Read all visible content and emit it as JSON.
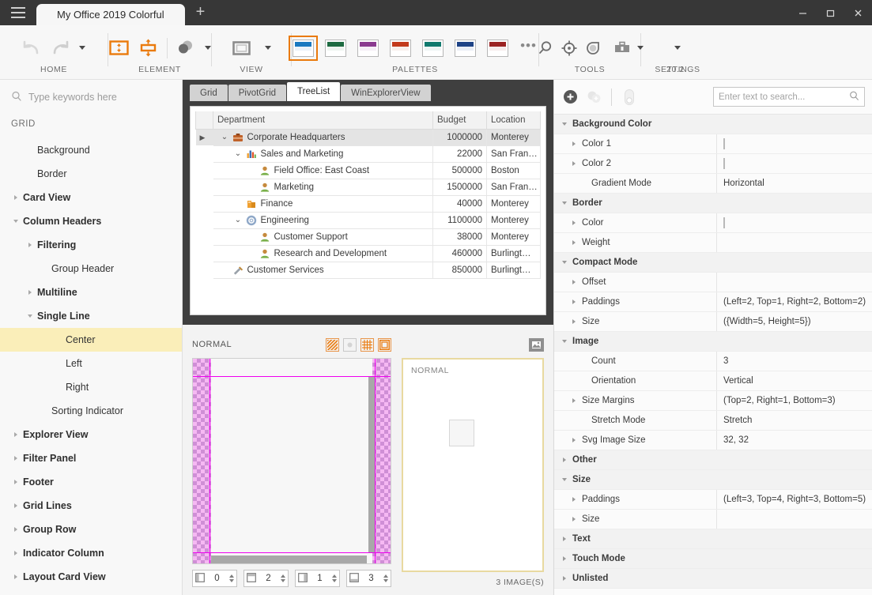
{
  "window": {
    "tab_title": "My Office 2019 Colorful",
    "add_tab": "+",
    "minimize": "minimize-icon",
    "maximize": "maximize-icon",
    "close": "close-icon"
  },
  "ribbon": {
    "groups": [
      {
        "caption": "HOME"
      },
      {
        "caption": "ELEMENT"
      },
      {
        "caption": "VIEW"
      },
      {
        "caption": "PALETTES"
      },
      {
        "caption": "TOOLS"
      },
      {
        "caption": "SETTINGS"
      }
    ],
    "version": "20.2",
    "more_label": "•••",
    "palettes": [
      {
        "name": "blue",
        "top": "#1a79c0",
        "bottom": "#ebf2f9",
        "selected": true
      },
      {
        "name": "green",
        "top": "#1e6b41",
        "bottom": "#eef4ef",
        "selected": false
      },
      {
        "name": "purple",
        "top": "#8a3a8f",
        "bottom": "#f5eef6",
        "selected": false
      },
      {
        "name": "orange",
        "top": "#c33a1c",
        "bottom": "#f8efec",
        "selected": false
      },
      {
        "name": "teal",
        "top": "#107a6e",
        "bottom": "#edf5f4",
        "selected": false
      },
      {
        "name": "navy",
        "top": "#1e4386",
        "bottom": "#eaeef6",
        "selected": false
      },
      {
        "name": "red",
        "top": "#9b2323",
        "bottom": "#f6ecec",
        "selected": false
      }
    ]
  },
  "sidebar": {
    "search_placeholder": "Type keywords here",
    "group_label": "GRID",
    "items": [
      {
        "label": "Background",
        "indent": 1,
        "twisty": "none",
        "bold": false,
        "selected": false
      },
      {
        "label": "Border",
        "indent": 1,
        "twisty": "none",
        "bold": false,
        "selected": false
      },
      {
        "label": "Card View",
        "indent": 0,
        "twisty": "right",
        "bold": true,
        "selected": false
      },
      {
        "label": "Column Headers",
        "indent": 0,
        "twisty": "down",
        "bold": true,
        "selected": false
      },
      {
        "label": "Filtering",
        "indent": 1,
        "twisty": "right",
        "bold": true,
        "selected": false
      },
      {
        "label": "Group Header",
        "indent": 2,
        "twisty": "none",
        "bold": false,
        "selected": false
      },
      {
        "label": "Multiline",
        "indent": 1,
        "twisty": "right",
        "bold": true,
        "selected": false
      },
      {
        "label": "Single Line",
        "indent": 1,
        "twisty": "down",
        "bold": true,
        "selected": false
      },
      {
        "label": "Center",
        "indent": 3,
        "twisty": "none",
        "bold": false,
        "selected": true
      },
      {
        "label": "Left",
        "indent": 3,
        "twisty": "none",
        "bold": false,
        "selected": false
      },
      {
        "label": "Right",
        "indent": 3,
        "twisty": "none",
        "bold": false,
        "selected": false
      },
      {
        "label": "Sorting Indicator",
        "indent": 2,
        "twisty": "none",
        "bold": false,
        "selected": false
      },
      {
        "label": "Explorer View",
        "indent": 0,
        "twisty": "right",
        "bold": true,
        "selected": false
      },
      {
        "label": "Filter Panel",
        "indent": 0,
        "twisty": "right",
        "bold": true,
        "selected": false
      },
      {
        "label": "Footer",
        "indent": 0,
        "twisty": "right",
        "bold": true,
        "selected": false
      },
      {
        "label": "Grid Lines",
        "indent": 0,
        "twisty": "right",
        "bold": true,
        "selected": false
      },
      {
        "label": "Group Row",
        "indent": 0,
        "twisty": "right",
        "bold": true,
        "selected": false
      },
      {
        "label": "Indicator Column",
        "indent": 0,
        "twisty": "right",
        "bold": true,
        "selected": false
      },
      {
        "label": "Layout Card View",
        "indent": 0,
        "twisty": "right",
        "bold": true,
        "selected": false
      }
    ]
  },
  "center": {
    "tabs": [
      {
        "label": "Grid",
        "active": false
      },
      {
        "label": "PivotGrid",
        "active": false
      },
      {
        "label": "TreeList",
        "active": true
      },
      {
        "label": "WinExplorerView",
        "active": false
      }
    ],
    "treelist": {
      "columns": [
        "Department",
        "Budget",
        "Location"
      ],
      "rows": [
        {
          "department": "Corporate Headquarters",
          "budget": "1000000",
          "location": "Monterey",
          "indent": 0,
          "twisty": "down",
          "icon": "briefcase-icon",
          "selected": true,
          "row_indicator": true
        },
        {
          "department": "Sales and Marketing",
          "budget": "22000",
          "location": "San Fran…",
          "indent": 1,
          "twisty": "down",
          "icon": "chart-icon",
          "selected": false,
          "row_indicator": false
        },
        {
          "department": "Field Office: East Coast",
          "budget": "500000",
          "location": "Boston",
          "indent": 2,
          "twisty": "none",
          "icon": "person-icon",
          "selected": false,
          "row_indicator": false
        },
        {
          "department": "Marketing",
          "budget": "1500000",
          "location": "San Fran…",
          "indent": 2,
          "twisty": "none",
          "icon": "person-icon",
          "selected": false,
          "row_indicator": false
        },
        {
          "department": "Finance",
          "budget": "40000",
          "location": "Monterey",
          "indent": 1,
          "twisty": "none",
          "icon": "money-icon",
          "selected": false,
          "row_indicator": false
        },
        {
          "department": "Engineering",
          "budget": "1100000",
          "location": "Monterey",
          "indent": 1,
          "twisty": "down",
          "icon": "gear-icon",
          "selected": false,
          "row_indicator": false
        },
        {
          "department": "Customer Support",
          "budget": "38000",
          "location": "Monterey",
          "indent": 2,
          "twisty": "none",
          "icon": "person-icon",
          "selected": false,
          "row_indicator": false
        },
        {
          "department": "Research and Development",
          "budget": "460000",
          "location": "Burlingt…",
          "indent": 2,
          "twisty": "none",
          "icon": "person-icon",
          "selected": false,
          "row_indicator": false
        },
        {
          "department": "Customer Services",
          "budget": "850000",
          "location": "Burlingt…",
          "indent": 0,
          "twisty": "none",
          "icon": "tools-icon",
          "selected": false,
          "row_indicator": false
        }
      ]
    },
    "preview": {
      "state_label": "NORMAL",
      "tools": [
        {
          "name": "hatch-fill-toggle",
          "active": true
        },
        {
          "name": "dot-marker-toggle",
          "active": false
        },
        {
          "name": "grid-overlay-toggle",
          "active": true
        },
        {
          "name": "frame-overlay-toggle",
          "active": true
        }
      ],
      "spinners": [
        {
          "name": "left-margin-spinner",
          "icon": "box-left-icon",
          "value": "0"
        },
        {
          "name": "top-margin-spinner",
          "icon": "box-top-icon",
          "value": "2"
        },
        {
          "name": "right-margin-spinner",
          "icon": "box-right-icon",
          "value": "1"
        },
        {
          "name": "bottom-margin-spinner",
          "icon": "box-bottom-icon",
          "value": "3"
        }
      ],
      "thumb_label": "NORMAL",
      "image_count_label": "3 IMAGE(S)",
      "image_button": "picture-icon"
    }
  },
  "props": {
    "toolbar": {
      "add": "add-circle-icon",
      "duplicate": "duplicate-icon",
      "toggle": "switch-icon"
    },
    "search_placeholder": "Enter text to search...",
    "rows": [
      {
        "type": "cat",
        "label": "Background Color",
        "twisty": "down",
        "value": ""
      },
      {
        "type": "prop",
        "label": "Color 1",
        "level": 1,
        "twisty": "right",
        "value": "",
        "swatch": true
      },
      {
        "type": "prop",
        "label": "Color 2",
        "level": 1,
        "twisty": "right",
        "value": "",
        "swatch": true
      },
      {
        "type": "prop",
        "label": "Gradient Mode",
        "level": 2,
        "twisty": "none",
        "value": "Horizontal"
      },
      {
        "type": "cat",
        "label": "Border",
        "twisty": "down",
        "value": ""
      },
      {
        "type": "prop",
        "label": "Color",
        "level": 1,
        "twisty": "right",
        "value": "",
        "swatch": true
      },
      {
        "type": "prop",
        "label": "Weight",
        "level": 1,
        "twisty": "right",
        "value": ""
      },
      {
        "type": "cat",
        "label": "Compact Mode",
        "twisty": "down",
        "value": ""
      },
      {
        "type": "prop",
        "label": "Offset",
        "level": 1,
        "twisty": "right",
        "value": ""
      },
      {
        "type": "prop",
        "label": "Paddings",
        "level": 1,
        "twisty": "right",
        "value": "(Left=2, Top=1, Right=2, Bottom=2)"
      },
      {
        "type": "prop",
        "label": "Size",
        "level": 1,
        "twisty": "right",
        "value": "({Width=5, Height=5})"
      },
      {
        "type": "cat",
        "label": "Image",
        "twisty": "down",
        "value": ""
      },
      {
        "type": "prop",
        "label": "Count",
        "level": 2,
        "twisty": "none",
        "value": "3"
      },
      {
        "type": "prop",
        "label": "Orientation",
        "level": 2,
        "twisty": "none",
        "value": "Vertical"
      },
      {
        "type": "prop",
        "label": "Size Margins",
        "level": 1,
        "twisty": "right",
        "value": "(Top=2, Right=1, Bottom=3)"
      },
      {
        "type": "prop",
        "label": "Stretch Mode",
        "level": 2,
        "twisty": "none",
        "value": "Stretch"
      },
      {
        "type": "prop",
        "label": "Svg Image Size",
        "level": 1,
        "twisty": "right",
        "value": "32, 32"
      },
      {
        "type": "cat",
        "label": "Other",
        "twisty": "right",
        "value": ""
      },
      {
        "type": "cat",
        "label": "Size",
        "twisty": "down",
        "value": ""
      },
      {
        "type": "prop",
        "label": "Paddings",
        "level": 1,
        "twisty": "right",
        "value": "(Left=3, Top=4, Right=3, Bottom=5)"
      },
      {
        "type": "prop",
        "label": "Size",
        "level": 1,
        "twisty": "right",
        "value": ""
      },
      {
        "type": "cat",
        "label": "Text",
        "twisty": "right",
        "value": ""
      },
      {
        "type": "cat",
        "label": "Touch Mode",
        "twisty": "right",
        "value": ""
      },
      {
        "type": "cat",
        "label": "Unlisted",
        "twisty": "right",
        "value": ""
      }
    ]
  },
  "colors": {
    "accent": "#ea7a0c",
    "titlebar": "#373737",
    "selection": "#faeeb9",
    "canvas_dark": "#3f3f3f"
  }
}
